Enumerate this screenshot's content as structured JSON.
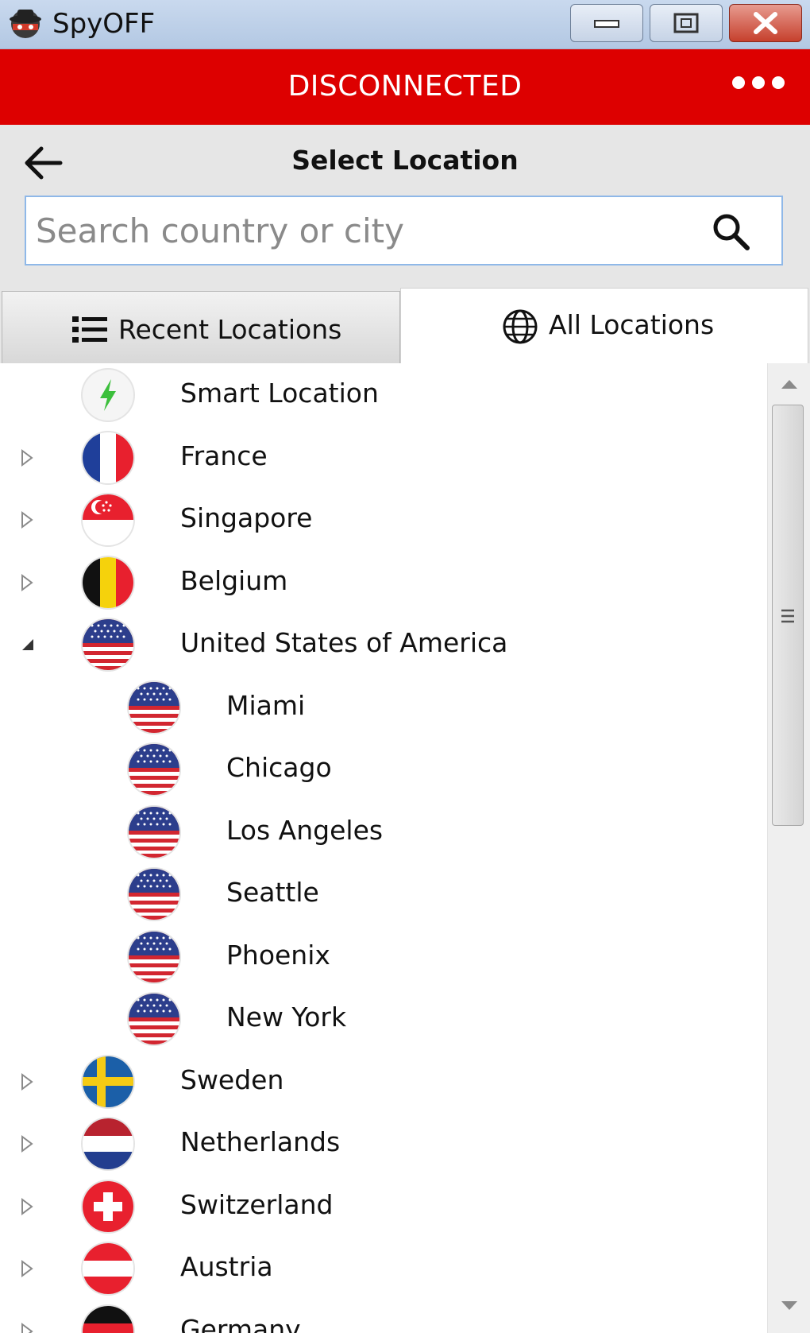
{
  "window": {
    "title": "SpyOFF"
  },
  "status": {
    "text": "DISCONNECTED",
    "color": "#dd0000"
  },
  "header": {
    "title": "Select Location"
  },
  "search": {
    "placeholder": "Search country or city",
    "value": ""
  },
  "tabs": [
    {
      "label": "Recent Locations",
      "icon": "list-icon",
      "selected": false
    },
    {
      "label": "All Locations",
      "icon": "globe-icon",
      "selected": true
    }
  ],
  "locations": [
    {
      "label": "Smart Location",
      "icon": "lightning-icon",
      "level": 0
    },
    {
      "label": "France",
      "flag": "france-flag-icon",
      "level": 0,
      "expanded": false
    },
    {
      "label": "Singapore",
      "flag": "singapore-flag-icon",
      "level": 0,
      "expanded": false
    },
    {
      "label": "Belgium",
      "flag": "belgium-flag-icon",
      "level": 0,
      "expanded": false
    },
    {
      "label": "United States of America",
      "flag": "usa-flag-icon",
      "level": 0,
      "expanded": true
    },
    {
      "label": "Miami",
      "flag": "usa-flag-icon",
      "level": 1
    },
    {
      "label": "Chicago",
      "flag": "usa-flag-icon",
      "level": 1
    },
    {
      "label": "Los Angeles",
      "flag": "usa-flag-icon",
      "level": 1
    },
    {
      "label": "Seattle",
      "flag": "usa-flag-icon",
      "level": 1
    },
    {
      "label": "Phoenix",
      "flag": "usa-flag-icon",
      "level": 1
    },
    {
      "label": "New York",
      "flag": "usa-flag-icon",
      "level": 1
    },
    {
      "label": "Sweden",
      "flag": "sweden-flag-icon",
      "level": 0,
      "expanded": false
    },
    {
      "label": "Netherlands",
      "flag": "netherlands-flag-icon",
      "level": 0,
      "expanded": false
    },
    {
      "label": "Switzerland",
      "flag": "switzerland-flag-icon",
      "level": 0,
      "expanded": false
    },
    {
      "label": "Austria",
      "flag": "austria-flag-icon",
      "level": 0,
      "expanded": false
    },
    {
      "label": "Germany",
      "flag": "germany-flag-icon",
      "level": 0,
      "expanded": false
    }
  ]
}
